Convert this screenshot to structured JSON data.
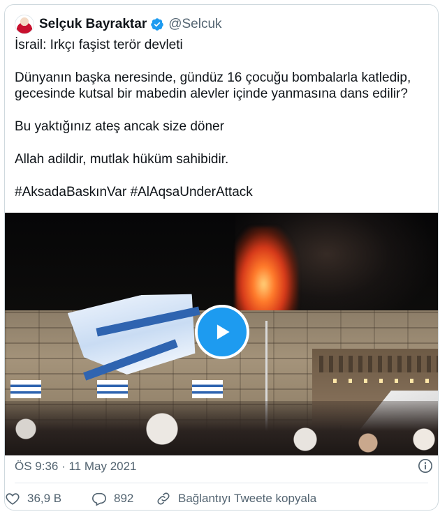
{
  "tweet": {
    "author": {
      "name": "Selçuk Bayraktar",
      "handle": "@Selcuk",
      "verified": true
    },
    "paragraphs": [
      "İsrail: Irkçı faşist terör devleti",
      "Dünyanın başka neresinde, gündüz 16 çocuğu bombalarla katledip, gecesinde kutsal bir mabedin alevler içinde yanmasına dans edilir?",
      "Bu yaktığınız ateş ancak size döner",
      "Allah adildir, mutlak hüküm sahibidir.",
      "#AksadaBaskınVar #AlAqsaUnderAttack"
    ],
    "hashtags": [
      "#AksadaBaskınVar",
      "#AlAqsaUnderAttack"
    ],
    "timestamp": "ÖS 9:36 · 11 May 2021",
    "likes": "36,9 B",
    "replies": "892",
    "copy_link_label": "Bağlantıyı Tweete kopyala",
    "media": {
      "type": "video",
      "control_icon": "play-icon"
    },
    "colors": {
      "accent": "#1d9bf0",
      "secondary_text": "#536471",
      "hashtag": "#0f1419"
    }
  }
}
